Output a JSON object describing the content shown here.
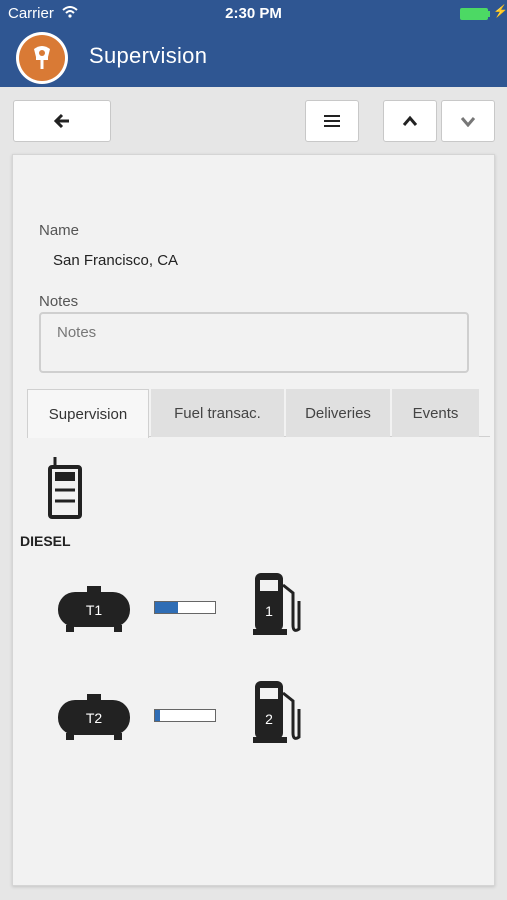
{
  "status_bar": {
    "carrier": "Carrier",
    "time": "2:30 PM"
  },
  "header": {
    "title": "Supervision"
  },
  "form": {
    "name_label": "Name",
    "name_value": "San Francisco, CA",
    "notes_label": "Notes",
    "notes_placeholder": "Notes"
  },
  "tabs": [
    "Supervision",
    "Fuel transac.",
    "Deliveries",
    "Events"
  ],
  "supervision": {
    "product": "DIESEL",
    "tanks": [
      {
        "label": "T1",
        "level_percent": 38,
        "pump": "1"
      },
      {
        "label": "T2",
        "level_percent": 8,
        "pump": "2"
      }
    ]
  },
  "colors": {
    "header": "#2f5692",
    "level_fill": "#2f6db5",
    "avatar": "#d97a35"
  }
}
